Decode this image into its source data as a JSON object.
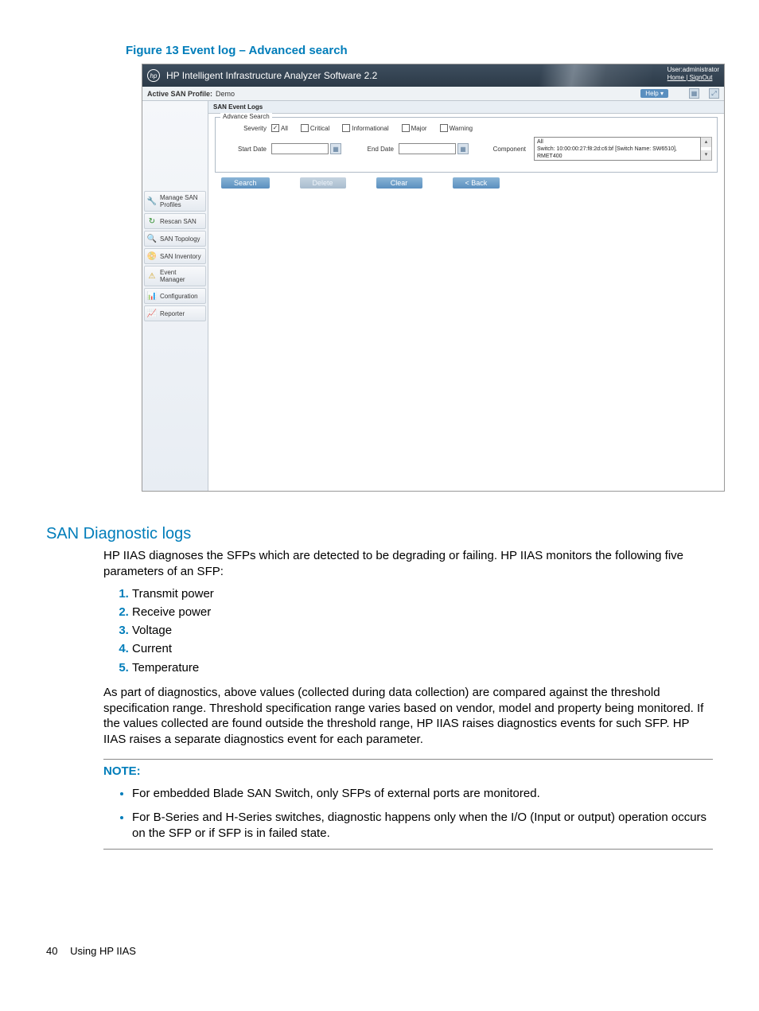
{
  "figure_caption": "Figure 13 Event log – Advanced search",
  "app": {
    "title": "HP Intelligent Infrastructure Analyzer Software 2.2",
    "user_label": "User:administrator",
    "home_link": "Home",
    "signout_link": "SignOut",
    "logo_text": "hp"
  },
  "toolbar": {
    "profile_label": "Active SAN Profile:",
    "profile_value": "Demo",
    "help_label": "Help ▾"
  },
  "sidebar": {
    "items": [
      {
        "icon": "🔧",
        "label": "Manage SAN Profiles"
      },
      {
        "icon": "↻",
        "label": "Rescan SAN"
      },
      {
        "icon": "🔍",
        "label": "SAN Topology"
      },
      {
        "icon": "📀",
        "label": "SAN Inventory"
      },
      {
        "icon": "⚠",
        "label": "Event Manager"
      },
      {
        "icon": "📊",
        "label": "Configuration"
      },
      {
        "icon": "📈",
        "label": "Reporter"
      }
    ]
  },
  "main": {
    "tab_title": "SAN Event Logs",
    "fieldset_legend": "Advance Search",
    "severity_label": "Severity",
    "severity_options": [
      "All",
      "Critical",
      "Informational",
      "Major",
      "Warning"
    ],
    "severity_checked": [
      true,
      false,
      false,
      false,
      false
    ],
    "start_date_label": "Start Date",
    "end_date_label": "End Date",
    "component_label": "Component",
    "component_options": [
      "All",
      "Switch: 10:00:00:27:f8:2d:c6:bf [Switch Name: SW6510],",
      "RMET400"
    ],
    "buttons": {
      "search": "Search",
      "delete": "Delete",
      "clear": "Clear",
      "back": "< Back"
    }
  },
  "doc": {
    "section_heading": "SAN Diagnostic logs",
    "intro": "HP IIAS diagnoses the SFPs which are detected to be degrading or failing. HP IIAS monitors the following five parameters of an SFP:",
    "params": [
      "Transmit power",
      "Receive power",
      "Voltage",
      "Current",
      "Temperature"
    ],
    "para2": "As part of diagnostics, above values (collected during data collection) are compared against the threshold specification range. Threshold specification range varies based on vendor, model and property being monitored. If the values collected are found outside the threshold range, HP IIAS raises diagnostics events for such SFP. HP IIAS raises a separate diagnostics event for each parameter.",
    "note_label": "NOTE:",
    "notes": [
      "For embedded Blade SAN Switch, only SFPs of external ports are monitored.",
      "For B-Series and H-Series switches, diagnostic happens only when the I/O (Input or output) operation occurs on the SFP or if SFP is in failed state."
    ]
  },
  "footer": {
    "page_num": "40",
    "section": "Using HP IIAS"
  }
}
